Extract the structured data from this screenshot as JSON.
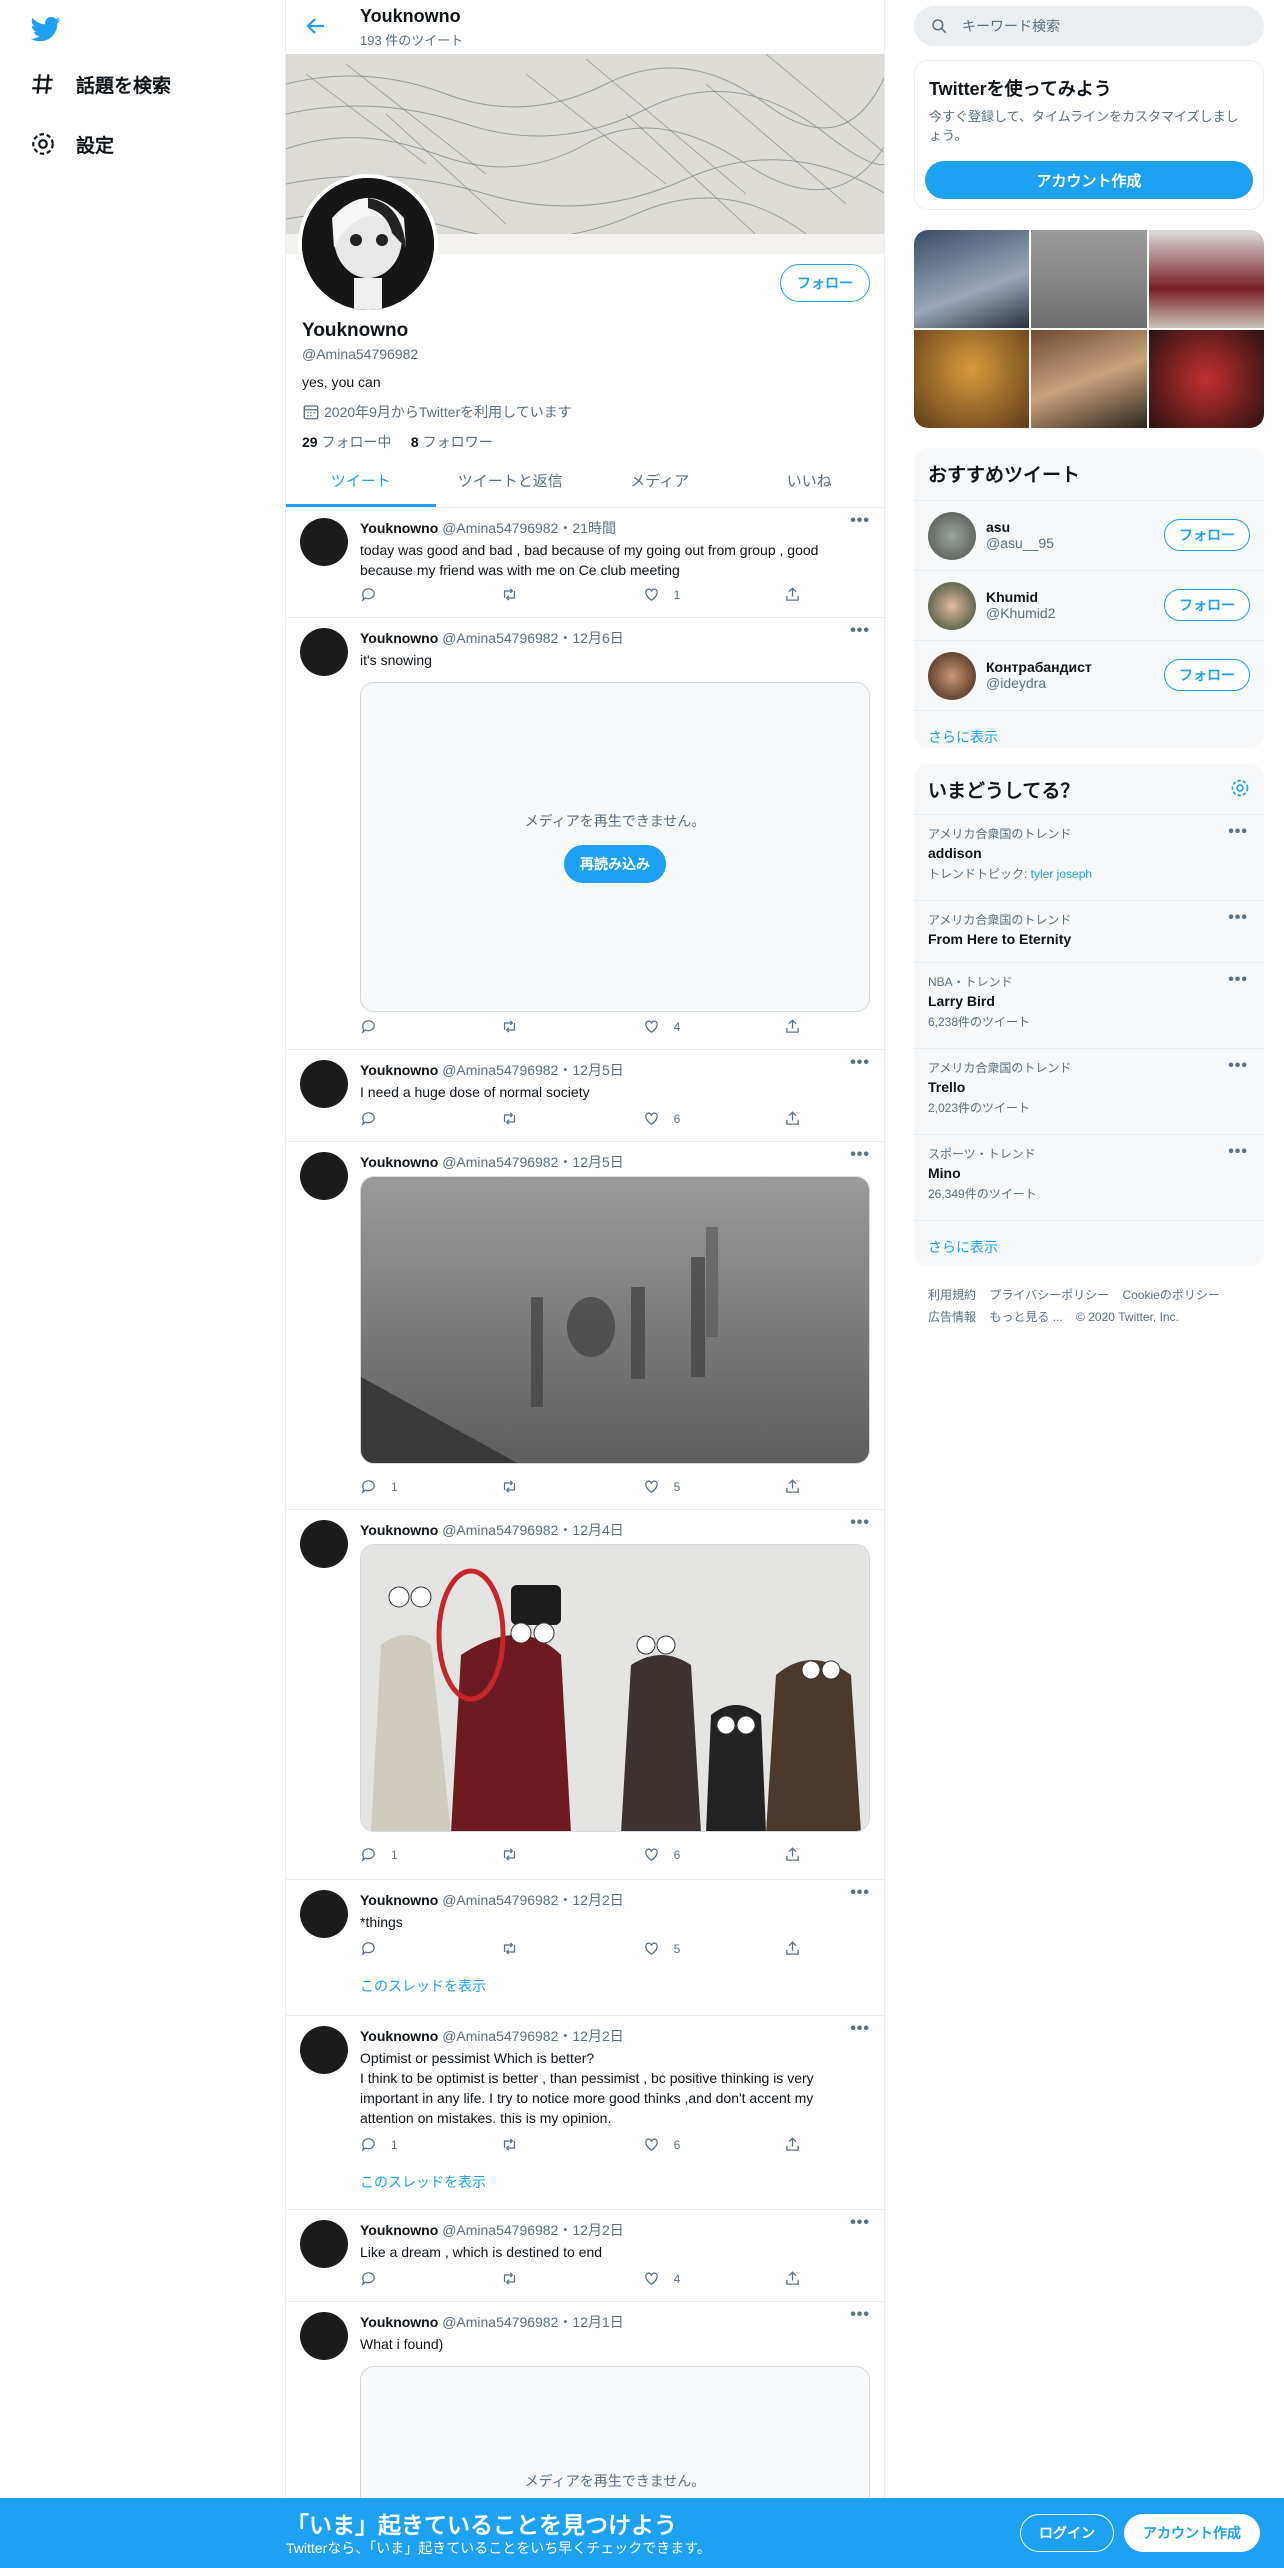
{
  "nav": {
    "explore": "話題を検索",
    "settings": "設定"
  },
  "header": {
    "name": "Youknowno",
    "tweet_count": "193 件のツイート"
  },
  "profile": {
    "follow": "フォロー",
    "name": "Youknowno",
    "handle": "@Amina54796982",
    "bio": "yes, you can",
    "joined": "2020年9月からTwitterを利用しています",
    "following_count": "29",
    "following_label": "フォロー中",
    "followers_count": "8",
    "followers_label": "フォロワー"
  },
  "tabs": [
    "ツイート",
    "ツイートと返信",
    "メディア",
    "いいね"
  ],
  "tweets": [
    {
      "name": "Youknowno",
      "meta": "@Amina54796982・21時間",
      "text": "today was good and bad , bad because of  my going out from group , good because my friend was with me on Ce club meeting",
      "reply": "",
      "rt": "",
      "like": "1"
    },
    {
      "name": "Youknowno",
      "meta": "@Amina54796982・12月6日",
      "text": "it's snowing",
      "media_error": "メディアを再生できません。",
      "reload": "再読み込み",
      "reply": "",
      "rt": "",
      "like": "4"
    },
    {
      "name": "Youknowno",
      "meta": "@Amina54796982・12月5日",
      "text": "I need a huge dose of normal society",
      "reply": "",
      "rt": "",
      "like": "6"
    },
    {
      "name": "Youknowno",
      "meta": "@Amina54796982・12月5日",
      "text": "",
      "reply": "1",
      "rt": "",
      "like": "5"
    },
    {
      "name": "Youknowno",
      "meta": "@Amina54796982・12月4日",
      "text": "",
      "reply": "1",
      "rt": "",
      "like": "6"
    },
    {
      "name": "Youknowno",
      "meta": "@Amina54796982・12月2日",
      "text": "*things",
      "reply": "",
      "rt": "",
      "like": "5",
      "thread": "このスレッドを表示"
    },
    {
      "name": "Youknowno",
      "meta": "@Amina54796982・12月2日",
      "text": "Optimist or pessimist Which is better?\nI think to be optimist is better , than pessimist , bc positive thinking is very important in any life. I try to notice more good thinks ,and don't accent my attention on mistakes. this is my opinion.",
      "reply": "1",
      "rt": "",
      "like": "6",
      "thread": "このスレッドを表示"
    },
    {
      "name": "Youknowno",
      "meta": "@Amina54796982・12月2日",
      "text": "Like a dream , which is destined to end",
      "reply": "",
      "rt": "",
      "like": "4"
    },
    {
      "name": "Youknowno",
      "meta": "@Amina54796982・12月1日",
      "text": "What i found)",
      "media_error": "メディアを再生できません。"
    }
  ],
  "search": {
    "placeholder": "キーワード検索"
  },
  "signup_card": {
    "title": "Twitterを使ってみよう",
    "desc": "今すぐ登録して、タイムラインをカスタマイズしましょう。",
    "button": "アカウント作成"
  },
  "who_to_follow": {
    "title": "おすすめツイート",
    "users": [
      {
        "name": "asu",
        "handle": "@asu__95",
        "button": "フォロー"
      },
      {
        "name": "Khumid",
        "handle": "@Khumid2",
        "button": "フォロー"
      },
      {
        "name": "Контрабандист",
        "handle": "@ideydra",
        "button": "フォロー"
      }
    ],
    "more": "さらに表示"
  },
  "trends": {
    "title": "いまどうしてる？",
    "items": [
      {
        "context": "アメリカ合衆国のトレンド",
        "topic": "addison",
        "sub_label": "トレンドトピック: ",
        "sub_link": "tyler joseph"
      },
      {
        "context": "アメリカ合衆国のトレンド",
        "topic": "From Here to Eternity"
      },
      {
        "context": "NBA・トレンド",
        "topic": "Larry Bird",
        "count": "6,238件のツイート"
      },
      {
        "context": "アメリカ合衆国のトレンド",
        "topic": "Trello",
        "count": "2,023件のツイート"
      },
      {
        "context": "スポーツ・トレンド",
        "topic": "Mino",
        "count": "26,349件のツイート"
      }
    ],
    "more": "さらに表示"
  },
  "footer": [
    "利用規約",
    "プライバシーポリシー",
    "Cookieのポリシー",
    "広告情報",
    "もっと見る ...",
    "© 2020 Twitter, Inc."
  ],
  "bottom_bar": {
    "title": "「いま」起きていることを見つけよう",
    "subtitle": "Twitterなら、「いま」起きていることをいち早くチェックできます。",
    "login": "ログイン",
    "signup": "アカウント作成"
  }
}
